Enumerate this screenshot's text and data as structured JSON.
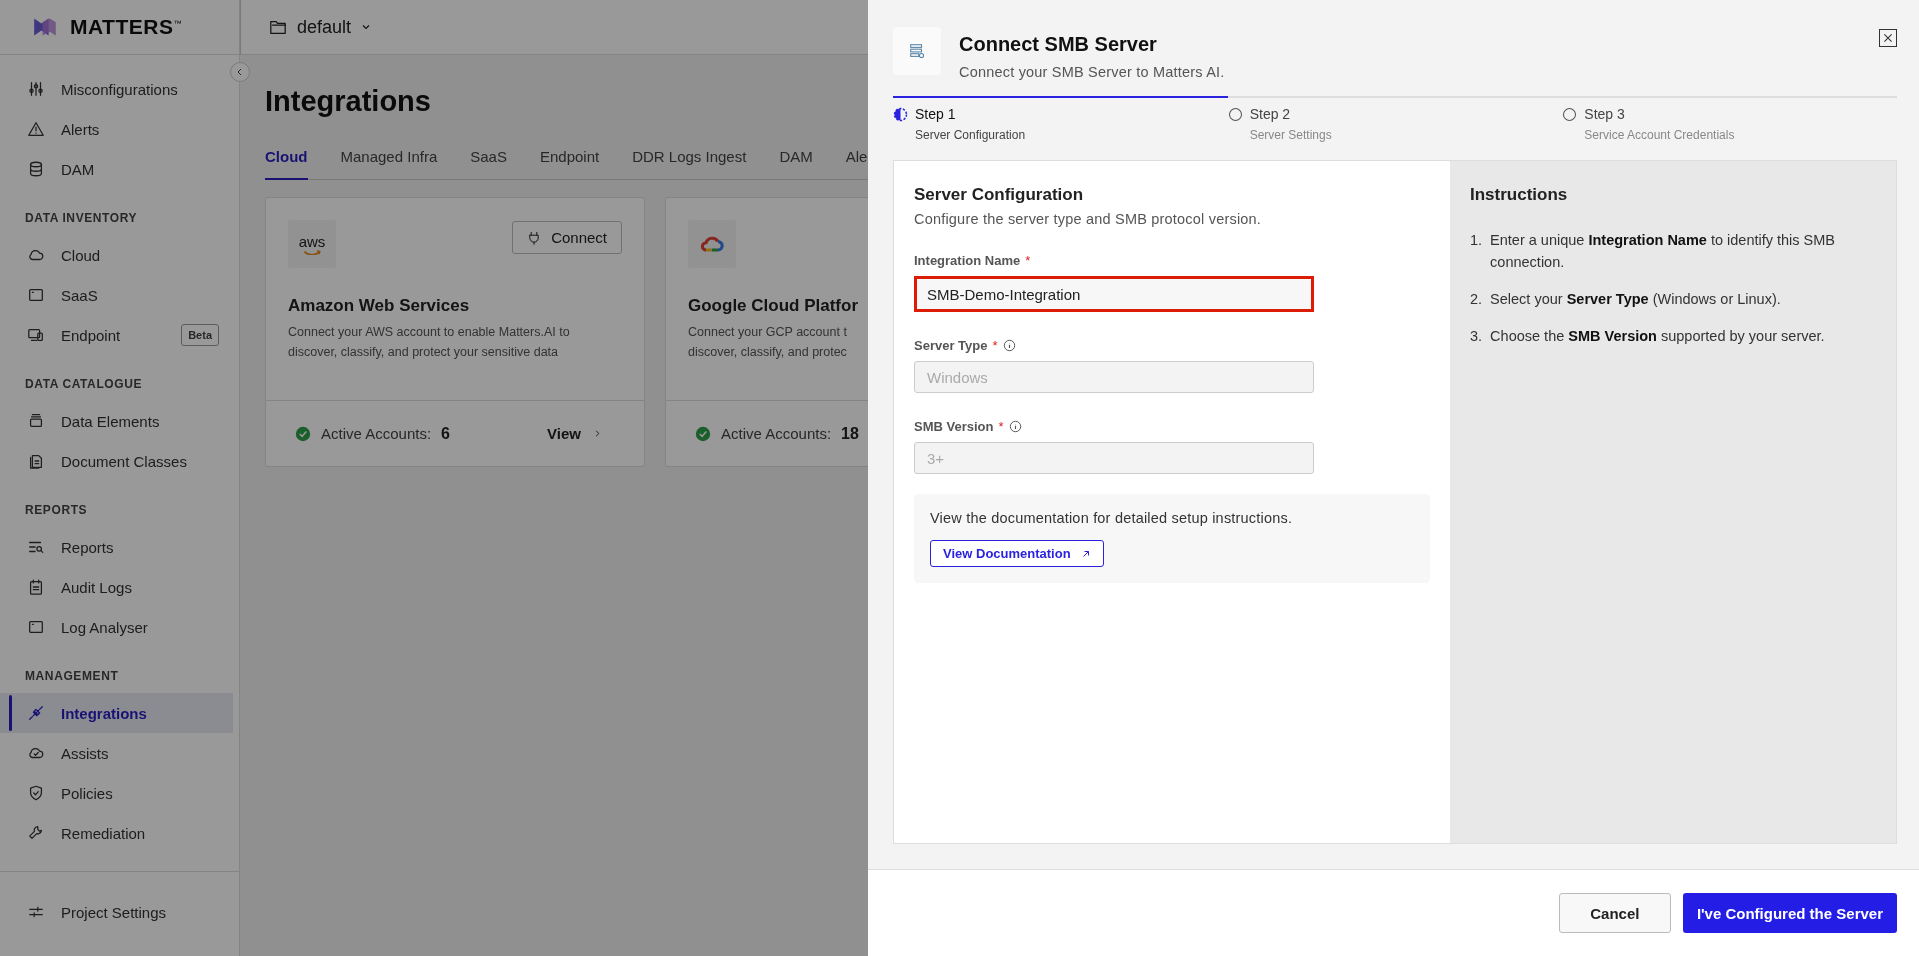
{
  "sidebar": {
    "logo": "MATTERS",
    "logo_mark": "™",
    "groups": [
      {
        "items": [
          {
            "label": "Misconfigurations",
            "selected": false
          },
          {
            "label": "Alerts",
            "selected": false
          },
          {
            "label": "DAM",
            "selected": false
          }
        ]
      },
      {
        "heading": "DATA INVENTORY",
        "items": [
          {
            "label": "Cloud",
            "selected": false
          },
          {
            "label": "SaaS",
            "selected": false
          },
          {
            "label": "Endpoint",
            "selected": false,
            "badge": "Beta"
          }
        ]
      },
      {
        "heading": "DATA CATALOGUE",
        "items": [
          {
            "label": "Data Elements",
            "selected": false
          },
          {
            "label": "Document Classes",
            "selected": false
          }
        ]
      },
      {
        "heading": "REPORTS",
        "items": [
          {
            "label": "Reports",
            "selected": false
          },
          {
            "label": "Audit Logs",
            "selected": false
          },
          {
            "label": "Log Analyser",
            "selected": false
          }
        ]
      },
      {
        "heading": "MANAGEMENT",
        "items": [
          {
            "label": "Integrations",
            "selected": true
          },
          {
            "label": "Assists",
            "selected": false
          },
          {
            "label": "Policies",
            "selected": false
          },
          {
            "label": "Remediation",
            "selected": false
          }
        ]
      }
    ],
    "footer_item": {
      "label": "Project Settings",
      "selected": false
    }
  },
  "topbar": {
    "project": "default"
  },
  "page": {
    "title": "Integrations",
    "tabs": [
      {
        "label": "Cloud",
        "selected": true
      },
      {
        "label": "Managed Infra",
        "selected": false
      },
      {
        "label": "SaaS",
        "selected": false
      },
      {
        "label": "Endpoint",
        "selected": false
      },
      {
        "label": "DDR Logs Ingest",
        "selected": false
      },
      {
        "label": "DAM",
        "selected": false
      },
      {
        "label": "Ale",
        "selected": false
      }
    ],
    "cards": [
      {
        "kind": "aws",
        "logo_text": "aws",
        "name": "Amazon Web Services",
        "description": "Connect your AWS account to enable Matters.AI to discover, classify, and protect your sensitive data",
        "button": "Connect",
        "active_label": "Active Accounts:",
        "count": "6",
        "link": "View"
      },
      {
        "kind": "gcp",
        "name": "Google Cloud Platfor",
        "description_lines": [
          "Connect your GCP account t",
          "discover, classify, and protec"
        ],
        "active_label": "Active Accounts:",
        "count": "18"
      }
    ]
  },
  "drawer": {
    "title": "Connect SMB Server",
    "subtitle": "Connect your SMB Server to Matters AI.",
    "steps": [
      {
        "label": "Step 1",
        "sublabel": "Server Configuration",
        "selected": true
      },
      {
        "label": "Step 2",
        "sublabel": "Server Settings",
        "selected": false
      },
      {
        "label": "Step 3",
        "sublabel": "Service Account Credentials",
        "selected": false
      }
    ],
    "form": {
      "heading": "Server Configuration",
      "subheading": "Configure the server type and SMB protocol version.",
      "fields": [
        {
          "label": "Integration Name",
          "required_mark": "*",
          "info": false,
          "value": "SMB-Demo-Integration",
          "disabled": false,
          "highlighted": true
        },
        {
          "label": "Server Type",
          "required_mark": "*",
          "info": true,
          "value": "Windows",
          "disabled": true,
          "highlighted": false
        },
        {
          "label": "SMB Version",
          "required_mark": "*",
          "info": true,
          "value": "3+",
          "disabled": true,
          "highlighted": false
        }
      ],
      "doc_text": "View the documentation for detailed setup instructions.",
      "doc_button": "View Documentation"
    },
    "instructions": {
      "title": "Instructions",
      "steps": [
        {
          "number": "1.",
          "text": "Enter a unique **Integration Name** to identify this SMB connection."
        },
        {
          "number": "2.",
          "text": "Select your **Server Type** (Windows or Linux)."
        },
        {
          "number": "3.",
          "text": "Choose the **SMB Version** supported by your server."
        }
      ]
    },
    "buttons": [
      {
        "label": "Cancel",
        "kind": "secondary"
      },
      {
        "label": "I've Configured the Server",
        "kind": "primary"
      }
    ]
  }
}
